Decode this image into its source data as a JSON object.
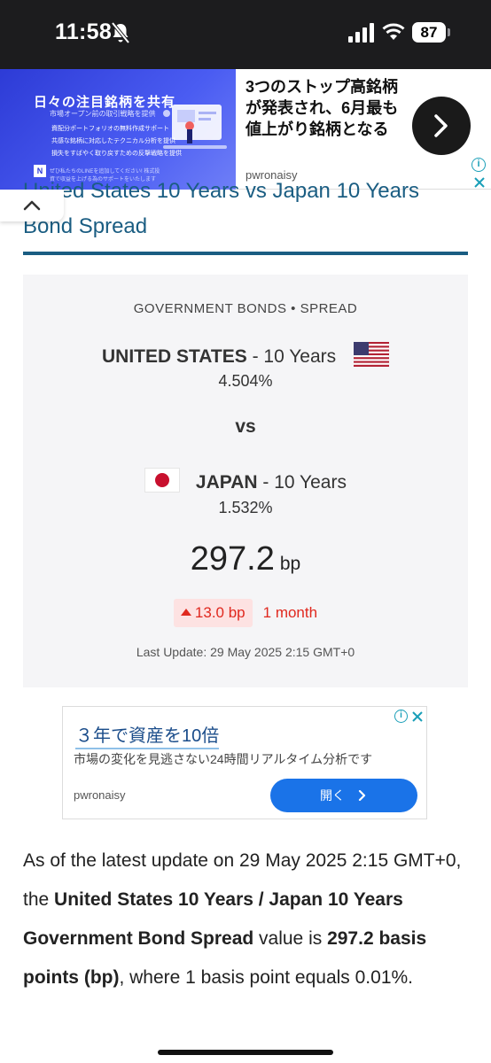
{
  "status_bar": {
    "time": "11:58",
    "battery": "87"
  },
  "top_ad": {
    "image_title": "日々の注目銘柄を共有",
    "image_subtitle": "市場オープン前の取引戦略を提供",
    "image_lines": [
      "資配分ポートフォリオの無料作成サポート",
      "共感な銘柄に対応したテクニカル分析を提供",
      "損失をすばやく取り戻すための反撃戦略を提供"
    ],
    "image_footer": "ぜひ私たちのLINEを追加してください! 株式投資で収益を上げる為のサポートをいたします",
    "image_logo": "N",
    "headline": "3つのストップ高銘柄が発表され、6月最も値上がり銘柄となる",
    "source": "pwronaisy"
  },
  "article": {
    "title": "United States 10 Years vs Japan 10 Years Bond Spread"
  },
  "spread_card": {
    "category": "GOVERNMENT BONDS • SPREAD",
    "country1": {
      "name": "UNITED STATES",
      "term": " - 10 Years",
      "yield": "4.504%"
    },
    "vs": "vs",
    "country2": {
      "name": "JAPAN",
      "term": " - 10 Years",
      "yield": "1.532%"
    },
    "spread_value": "297.2",
    "spread_unit": "bp",
    "change": "13.0 bp",
    "change_direction": "up",
    "change_period": "1 month",
    "last_update": "Last Update: 29 May 2025 2:15 GMT+0",
    "colors": {
      "negative": "#e0281e",
      "badge_bg": "#fde2e2",
      "accent": "#1a5d82"
    }
  },
  "mid_ad": {
    "title": "３年で資産を10倍",
    "description": "市場の変化を見逃さない24時間リアルタイム分析です",
    "source": "pwronaisy",
    "button_label": "開く"
  },
  "body": {
    "p1": "As of the latest update on 29 May 2025 2:15 GMT+0, the ",
    "b1": "United States 10 Years / Japan 10 Years Government Bond Spread",
    "p2": " value is ",
    "b2": "297.2 basis points (bp)",
    "p3": ", where 1 basis point equals 0.01%."
  }
}
